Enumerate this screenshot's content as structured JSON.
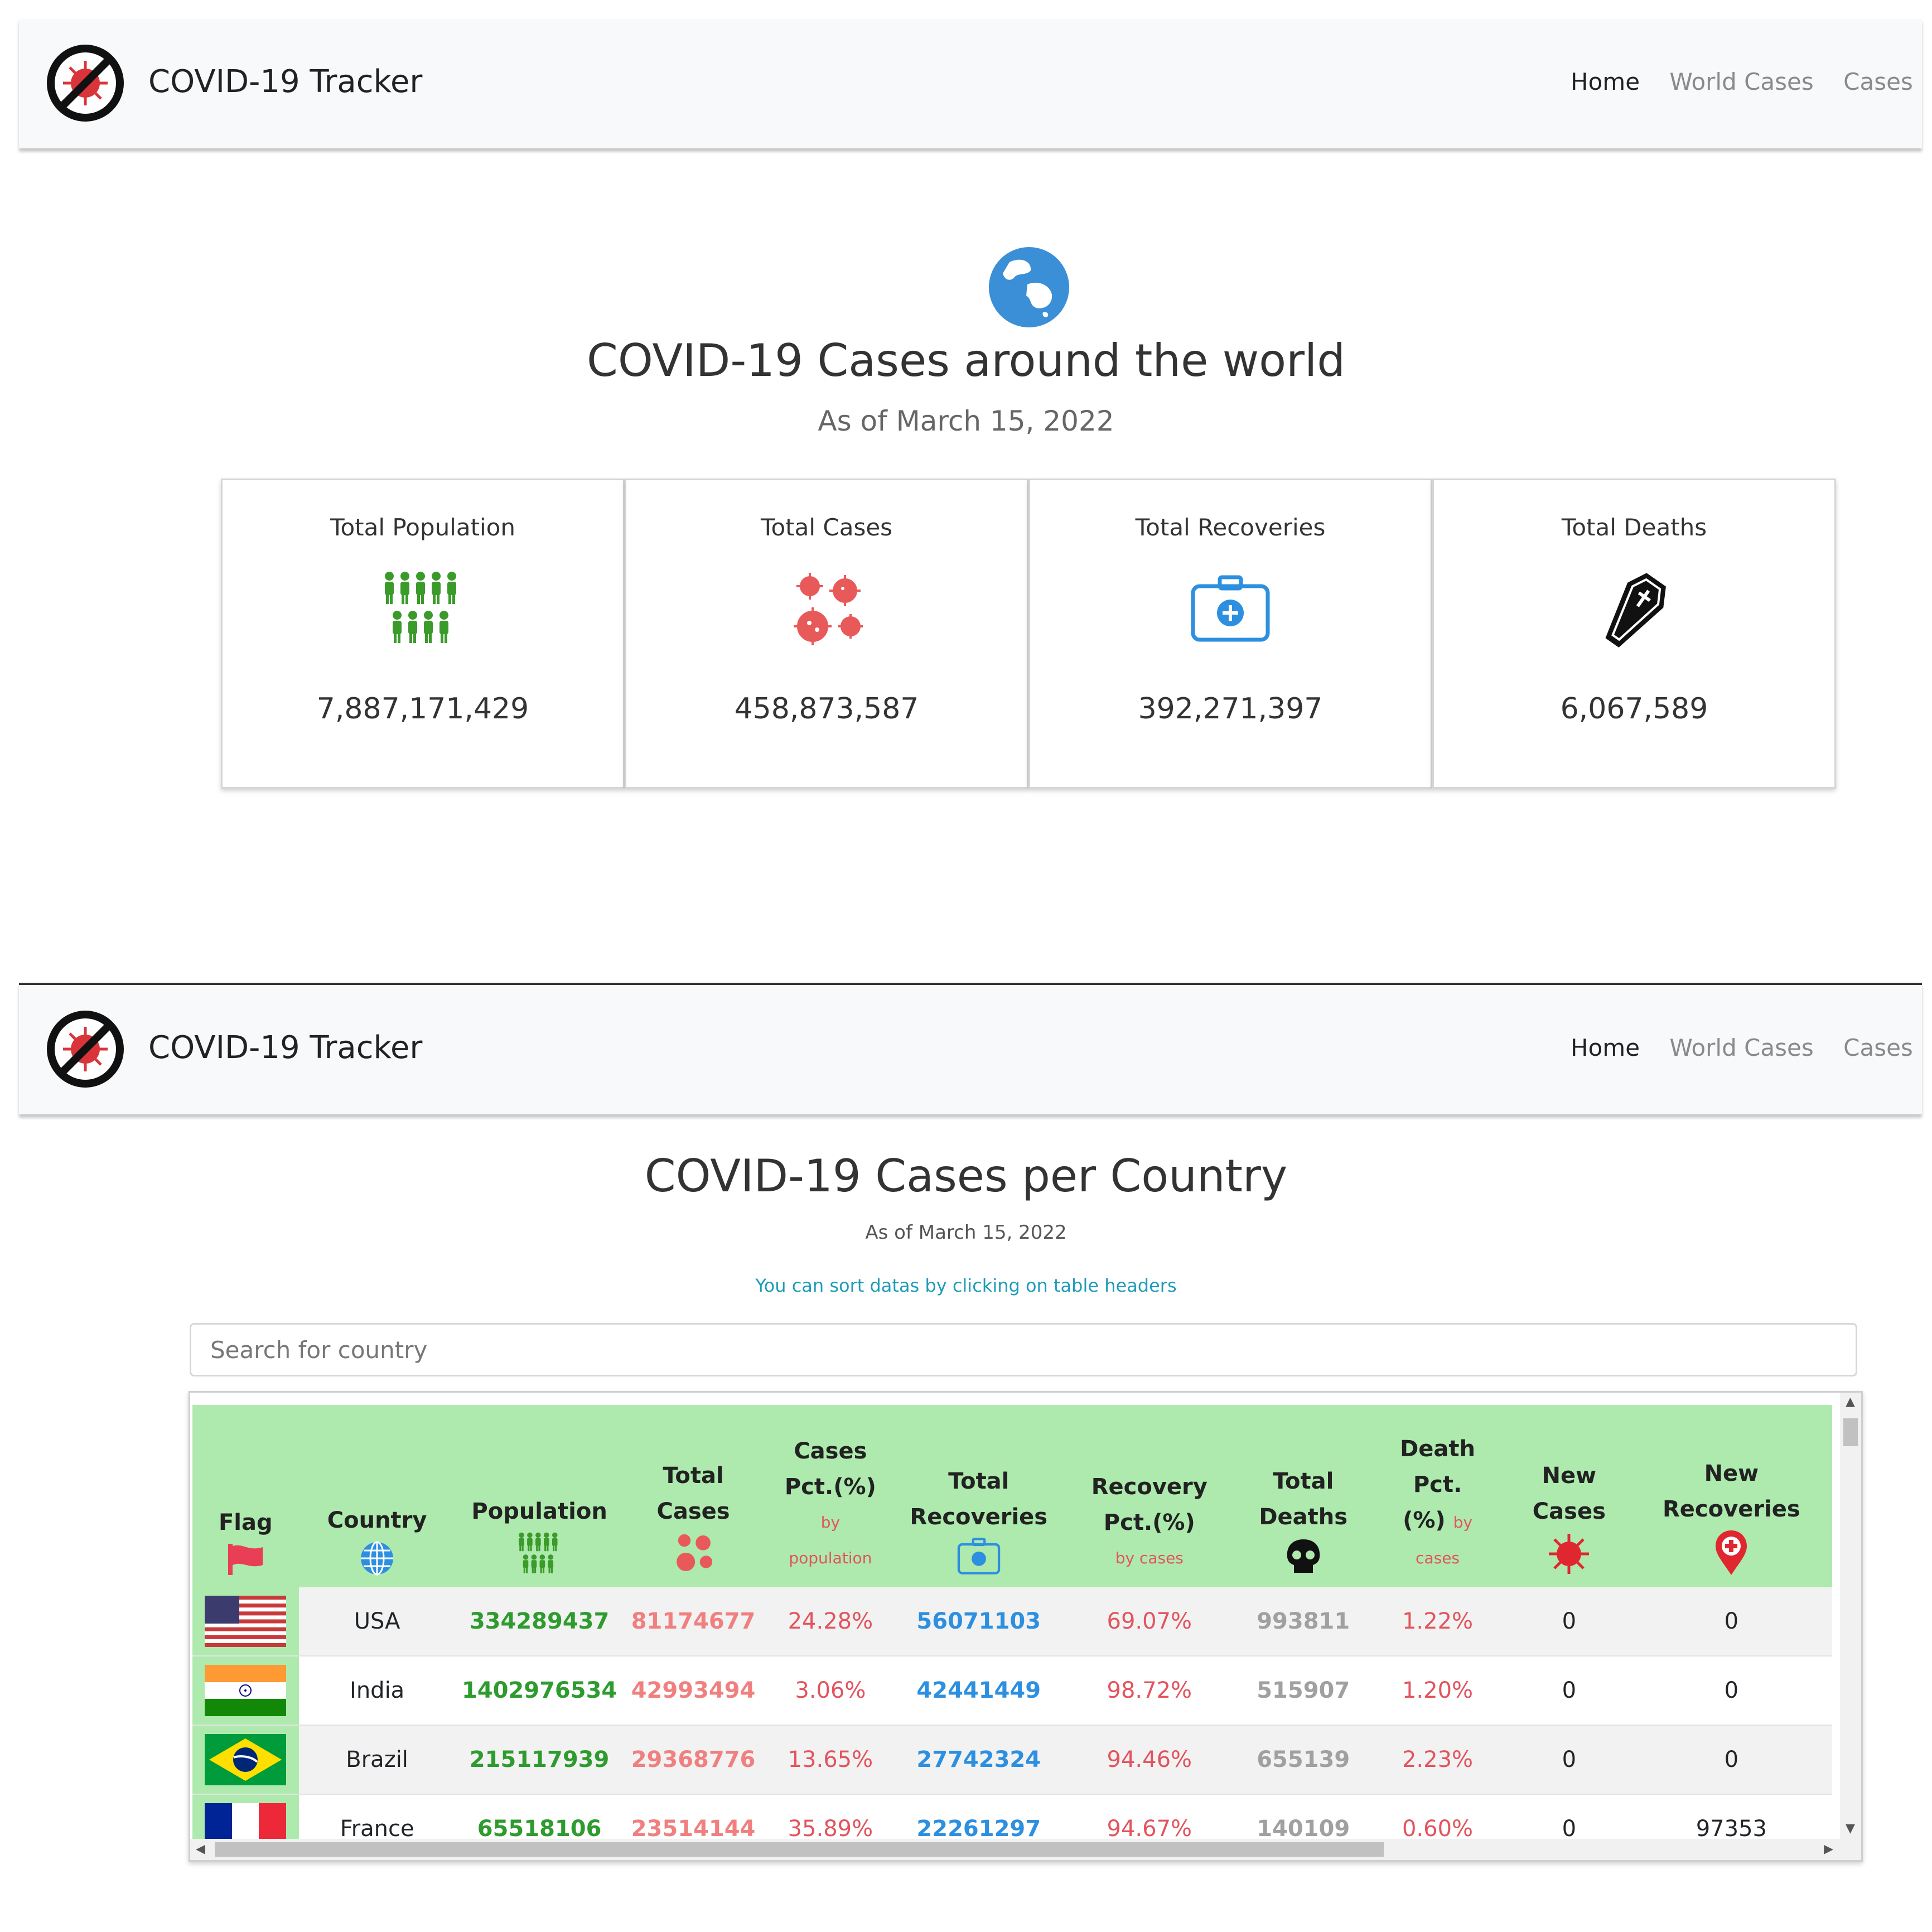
{
  "brand": {
    "name": "COVID-19 Tracker"
  },
  "nav": {
    "home": "Home",
    "world_cases": "World Cases",
    "cases_per": "Cases per"
  },
  "nav2": {
    "cases_per": "Cases per c"
  },
  "world": {
    "title": "COVID-19 Cases around the world",
    "subtitle": "As of March 15, 2022",
    "cards": [
      {
        "label": "Total Population",
        "value": "7,887,171,429",
        "icon": "people-icon",
        "color": "#3a9a2a"
      },
      {
        "label": "Total Cases",
        "value": "458,873,587",
        "icon": "virus-icon",
        "color": "#e85a5a"
      },
      {
        "label": "Total Recoveries",
        "value": "392,271,397",
        "icon": "medkit-icon",
        "color": "#2d8fe0"
      },
      {
        "label": "Total Deaths",
        "value": "6,067,589",
        "icon": "coffin-icon",
        "color": "#111111"
      }
    ]
  },
  "countries": {
    "title": "COVID-19 Cases per Country",
    "subtitle": "As of March 15, 2022",
    "hint": "You can sort datas by clicking on table headers",
    "search_placeholder": "Search for country",
    "headers": {
      "flag": "Flag",
      "country": "Country",
      "population": "Population",
      "total_cases_1": "Total",
      "total_cases_2": "Cases",
      "cases_pct_1": "Cases",
      "cases_pct_2": "Pct.(%)",
      "cases_pct_small_1": "by",
      "cases_pct_small_2": "population",
      "total_rec_1": "Total",
      "total_rec_2": "Recoveries",
      "rec_pct_1": "Recovery",
      "rec_pct_2": "Pct.(%)",
      "rec_pct_small": "by cases",
      "total_deaths_1": "Total",
      "total_deaths_2": "Deaths",
      "death_pct_1": "Death",
      "death_pct_2": "Pct.",
      "death_pct_3": "(%)",
      "death_pct_small_1": "by",
      "death_pct_small_2": "cases",
      "new_cases_1": "New",
      "new_cases_2": "Cases",
      "new_rec_1": "New",
      "new_rec_2": "Recoveries"
    },
    "rows": [
      {
        "flag": "usa-flag",
        "country": "USA",
        "population": "334289437",
        "cases": "81174677",
        "cases_pct": "24.28%",
        "recoveries": "56071103",
        "rec_pct": "69.07%",
        "deaths": "993811",
        "death_pct": "1.22%",
        "new_cases": "0",
        "new_rec": "0"
      },
      {
        "flag": "india-flag",
        "country": "India",
        "population": "1402976534",
        "cases": "42993494",
        "cases_pct": "3.06%",
        "recoveries": "42441449",
        "rec_pct": "98.72%",
        "deaths": "515907",
        "death_pct": "1.20%",
        "new_cases": "0",
        "new_rec": "0"
      },
      {
        "flag": "brazil-flag",
        "country": "Brazil",
        "population": "215117939",
        "cases": "29368776",
        "cases_pct": "13.65%",
        "recoveries": "27742324",
        "rec_pct": "94.46%",
        "deaths": "655139",
        "death_pct": "2.23%",
        "new_cases": "0",
        "new_rec": "0"
      },
      {
        "flag": "france-flag",
        "country": "France",
        "population": "65518106",
        "cases": "23514144",
        "cases_pct": "35.89%",
        "recoveries": "22261297",
        "rec_pct": "94.67%",
        "deaths": "140109",
        "death_pct": "0.60%",
        "new_cases": "0",
        "new_rec": "97353"
      }
    ]
  }
}
